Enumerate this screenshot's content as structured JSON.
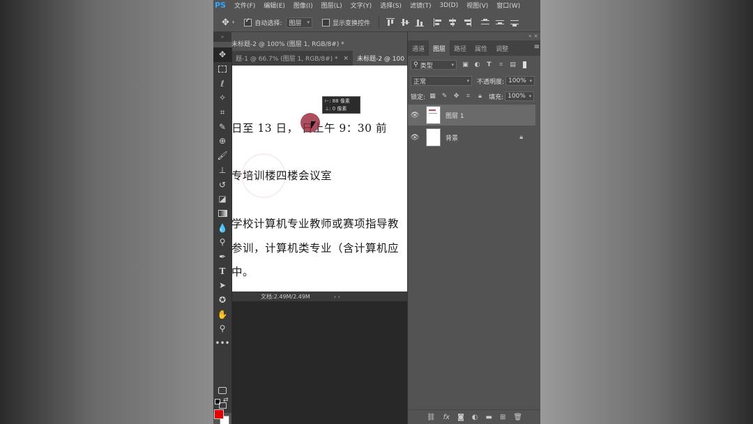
{
  "app": {
    "logo": "PS",
    "menu": [
      "文件(F)",
      "编辑(E)",
      "图像(I)",
      "图层(L)",
      "文字(Y)",
      "选择(S)",
      "滤镜(T)",
      "3D(D)",
      "视图(V)",
      "窗口(W)"
    ]
  },
  "options": {
    "auto_select_label": "自动选择:",
    "auto_select_checked": true,
    "auto_select_value": "图层",
    "transform_label": "显示变换控件",
    "transform_checked": false
  },
  "document": {
    "title": "未标题-2 @ 100% (图层 1, RGB/8#) *",
    "tabs": [
      {
        "label": "题-1 @ 66.7% (图层 1, RGB/8#) *",
        "close": "×",
        "active": false
      },
      {
        "label": "未标题-2 @ 100",
        "close": "",
        "active": true
      }
    ],
    "lines": [
      "日至 13 日，   日上午 9：30 前",
      "专培训楼四楼会议室",
      "学校计算机专业教师或赛项指导教",
      "参训，计算机类专业（含计算机应",
      "中。"
    ],
    "tooltip": [
      "⊢: 88 像素",
      "⊥: 0 像素"
    ],
    "status": "文档:2.49M/2.49M",
    "status_nav": "› ‹"
  },
  "panel": {
    "tabs": [
      "通道",
      "图层",
      "路径",
      "属性",
      "调整"
    ],
    "active_tab": "图层",
    "filter_kind": "类型",
    "blend_mode": "正常",
    "opacity_label": "不透明度:",
    "opacity": "100%",
    "lock_label": "锁定:",
    "fill_label": "填充:",
    "fill": "100%",
    "layers": [
      {
        "name": "图层 1",
        "selected": true,
        "locked": false
      },
      {
        "name": "背景",
        "selected": false,
        "locked": true
      }
    ]
  },
  "colors": {
    "foreground": "#e00000",
    "background": "#ffffff",
    "accent": "#31a8ff"
  }
}
